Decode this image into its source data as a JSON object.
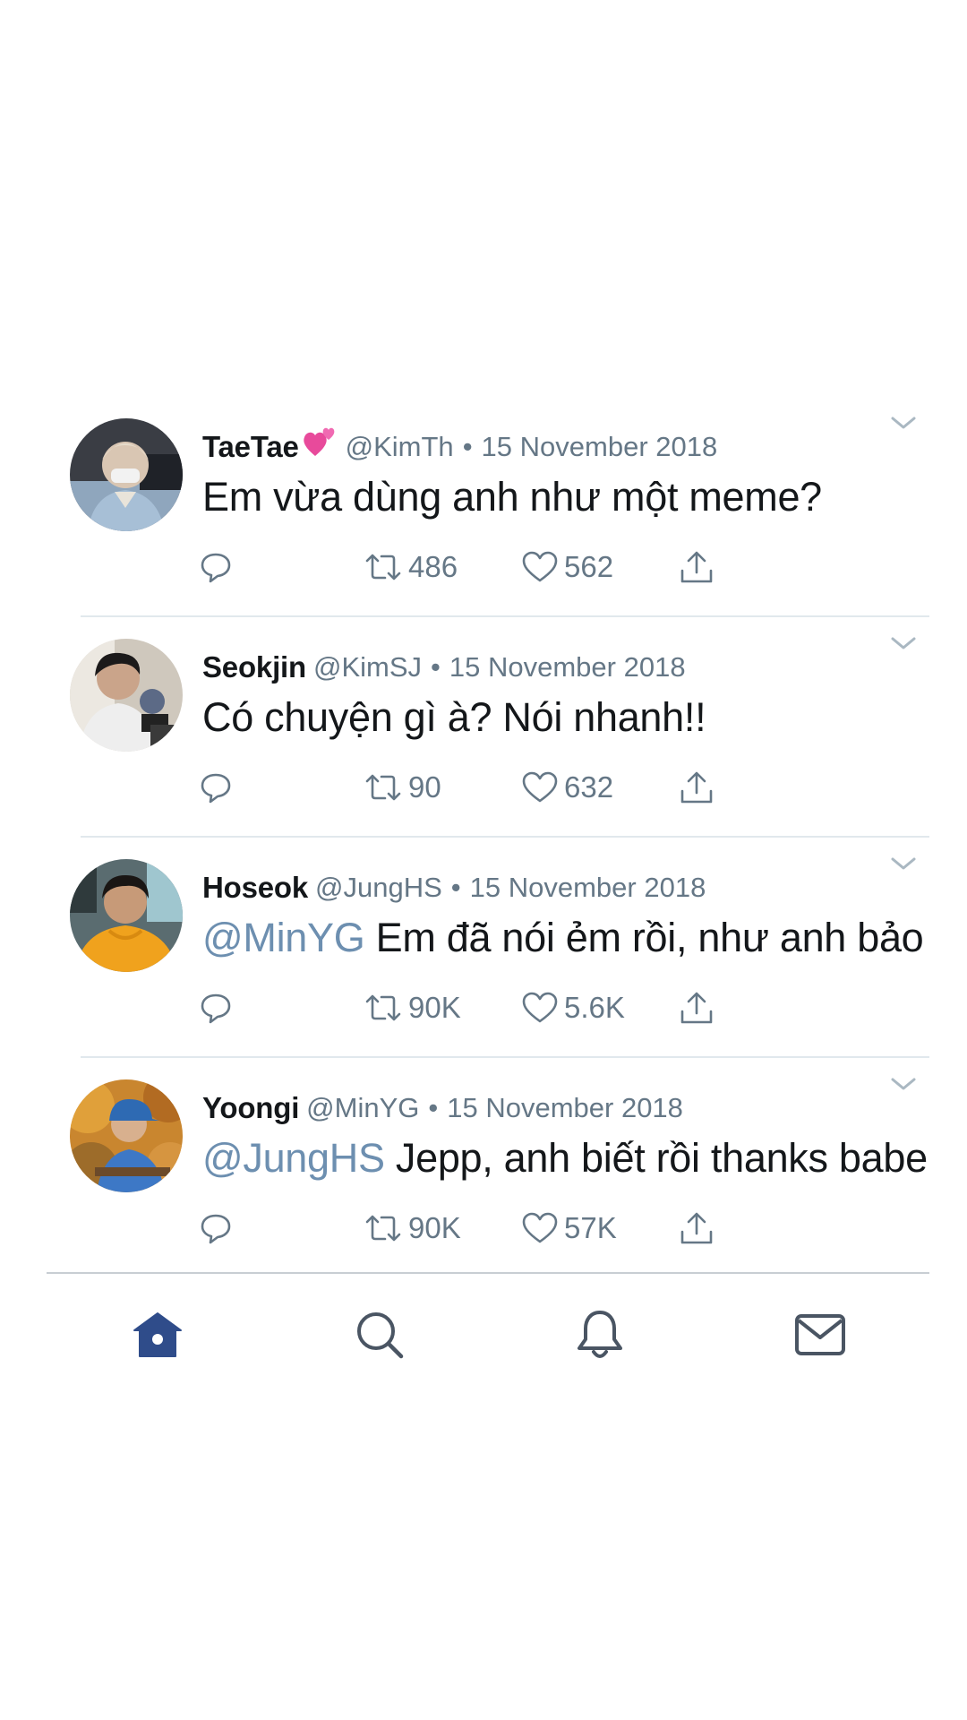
{
  "colors": {
    "text": "#14171a",
    "muted": "#657786",
    "mention": "#6d8fb0",
    "active_tab": "#2f4c8a",
    "divider": "#e1e8ed"
  },
  "tweets": [
    {
      "name": "TaeTae",
      "handle": "@KimTh",
      "separator": "•",
      "date": "15 November 2018",
      "mention": "",
      "text": "Em vừa dùng anh như một meme?",
      "retweets": "486",
      "likes": "562",
      "avatar_icon": "avatar-photo"
    },
    {
      "name": "Seokjin",
      "handle": "@KimSJ",
      "separator": "•",
      "date": "15 November 2018",
      "mention": "",
      "text": "Có chuyện gì à? Nói nhanh!!",
      "retweets": "90",
      "likes": "632",
      "avatar_icon": "avatar-photo"
    },
    {
      "name": "Hoseok",
      "handle": "@JungHS",
      "separator": "•",
      "date": "15 November 2018",
      "mention": "@MinYG",
      "text": "Em đã nói ẻm rồi, như anh bảo",
      "retweets": "90K",
      "likes": "5.6K",
      "avatar_icon": "avatar-photo"
    },
    {
      "name": "Yoongi",
      "handle": "@MinYG",
      "separator": "•",
      "date": "15 November 2018",
      "mention": "@JungHS",
      "text": "Jepp, anh biết rồi thanks babe",
      "retweets": "90K",
      "likes": "57K",
      "avatar_icon": "avatar-photo"
    }
  ],
  "tabs": [
    {
      "icon": "home-icon",
      "active": true
    },
    {
      "icon": "search-icon",
      "active": false
    },
    {
      "icon": "bell-icon",
      "active": false
    },
    {
      "icon": "mail-icon",
      "active": false
    }
  ]
}
